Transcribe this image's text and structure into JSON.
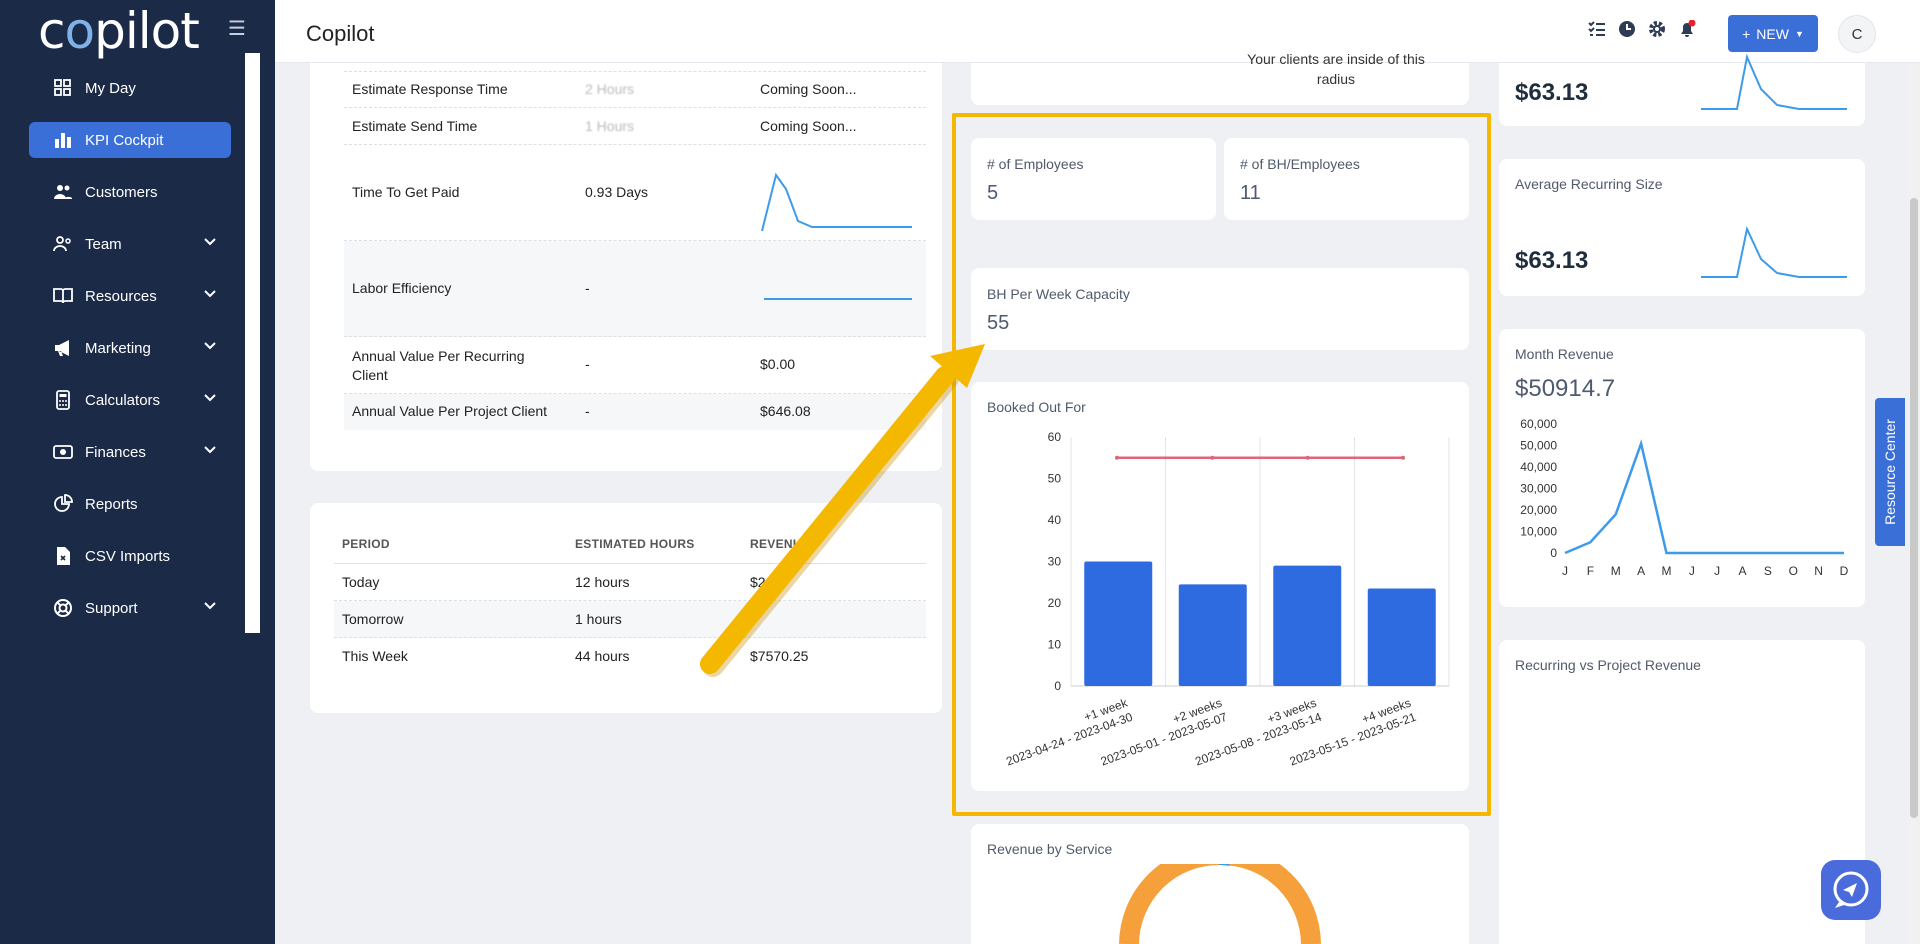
{
  "app": {
    "logo": "copilot",
    "title": "Copilot"
  },
  "sidebar": {
    "items": [
      {
        "label": "My Day",
        "icon": "grid-icon",
        "chevron": false,
        "active": false
      },
      {
        "label": "KPI Cockpit",
        "icon": "bar-chart-icon",
        "chevron": false,
        "active": true
      },
      {
        "label": "Customers",
        "icon": "users-icon",
        "chevron": false,
        "active": false
      },
      {
        "label": "Team",
        "icon": "team-icon",
        "chevron": true,
        "active": false
      },
      {
        "label": "Resources",
        "icon": "book-icon",
        "chevron": true,
        "active": false
      },
      {
        "label": "Marketing",
        "icon": "megaphone-icon",
        "chevron": true,
        "active": false
      },
      {
        "label": "Calculators",
        "icon": "calculator-icon",
        "chevron": true,
        "active": false
      },
      {
        "label": "Finances",
        "icon": "money-icon",
        "chevron": true,
        "active": false
      },
      {
        "label": "Reports",
        "icon": "pie-icon",
        "chevron": false,
        "active": false
      },
      {
        "label": "CSV Imports",
        "icon": "file-icon",
        "chevron": false,
        "active": false
      },
      {
        "label": "Support",
        "icon": "lifebuoy-icon",
        "chevron": true,
        "active": false
      }
    ]
  },
  "header": {
    "new_label": "NEW",
    "avatar": "C"
  },
  "metrics": {
    "rows": [
      {
        "name": "Estimate Response Time",
        "value": "2 Hours",
        "extra": "Coming Soon...",
        "blurred": true
      },
      {
        "name": "Estimate Send Time",
        "value": "1 Hours",
        "extra": "Coming Soon...",
        "blurred": true
      },
      {
        "name": "Time To Get Paid",
        "value": "0.93 Days",
        "extra": ""
      },
      {
        "name": "Labor Efficiency",
        "value": "-",
        "extra": ""
      },
      {
        "name": "Annual Value Per Recurring Client",
        "value": "-",
        "extra": "$0.00"
      },
      {
        "name": "Annual Value Per Project Client",
        "value": "-",
        "extra": "$646.08"
      }
    ]
  },
  "period_table": {
    "headers": [
      "PERIOD",
      "ESTIMATED HOURS",
      "REVENUE"
    ],
    "rows": [
      [
        "Today",
        "12 hours",
        "$22..."
      ],
      [
        "Tomorrow",
        "1 hours",
        ""
      ],
      [
        "This Week",
        "44 hours",
        "$7570.25"
      ]
    ]
  },
  "radius_text": "Your clients are inside of this radius",
  "kpis": {
    "employees_label": "# of Employees",
    "employees_value": "5",
    "bh_label": "# of BH/Employees",
    "bh_value": "11",
    "capacity_label": "BH Per Week Capacity",
    "capacity_value": "55"
  },
  "booked_out": {
    "title": "Booked Out For",
    "chart_data": {
      "type": "bar",
      "categories": [
        "+1 week 2023-04-24 - 2023-04-30",
        "+2 weeks 2023-05-01 - 2023-05-07",
        "+3 weeks 2023-05-08 - 2023-05-14",
        "+4 weeks 2023-05-15 - 2023-05-21"
      ],
      "category_lines": [
        [
          "+1 week",
          "2023-04-24 - 2023-04-30"
        ],
        [
          "+2 weeks",
          "2023-05-01 - 2023-05-07"
        ],
        [
          "+3 weeks",
          "2023-05-08 - 2023-05-14"
        ],
        [
          "+4 weeks",
          "2023-05-15 - 2023-05-21"
        ]
      ],
      "series": [
        {
          "type": "bar",
          "values": [
            30,
            24.5,
            29,
            23.5
          ],
          "color": "#2f6be0"
        },
        {
          "type": "line",
          "values": [
            55,
            55,
            55,
            55
          ],
          "color": "#e06677"
        }
      ],
      "yticks": [
        0,
        10,
        20,
        30,
        40,
        50,
        60
      ],
      "ylim": [
        0,
        60
      ]
    }
  },
  "revenue_by_service": {
    "title": "Revenue by Service"
  },
  "right": {
    "top_value": "$63.13",
    "avg_recurring_label": "Average Recurring Size",
    "avg_recurring_value": "$63.13",
    "month_revenue_label": "Month Revenue",
    "month_revenue_value": "$50914.7",
    "month_chart": {
      "type": "line",
      "categories": [
        "J",
        "F",
        "M",
        "A",
        "M",
        "J",
        "J",
        "A",
        "S",
        "O",
        "N",
        "D"
      ],
      "values": [
        0,
        5000,
        18000,
        50914.7,
        0,
        0,
        0,
        0,
        0,
        0,
        0,
        0
      ],
      "yticks": [
        0,
        10000,
        20000,
        30000,
        40000,
        50000,
        60000
      ],
      "ytick_labels": [
        "0",
        "10,000",
        "20,000",
        "30,000",
        "40,000",
        "50,000",
        "60,000"
      ],
      "ylim": [
        0,
        60000
      ],
      "color": "#3d9be9"
    },
    "recurring_vs_project_label": "Recurring vs Project Revenue"
  },
  "resource_center": "Resource Center",
  "colors": {
    "sidebar": "#1b2a47",
    "accent": "#3b6fd8",
    "highlight": "#f5b800",
    "arrow": "#f5b800"
  }
}
